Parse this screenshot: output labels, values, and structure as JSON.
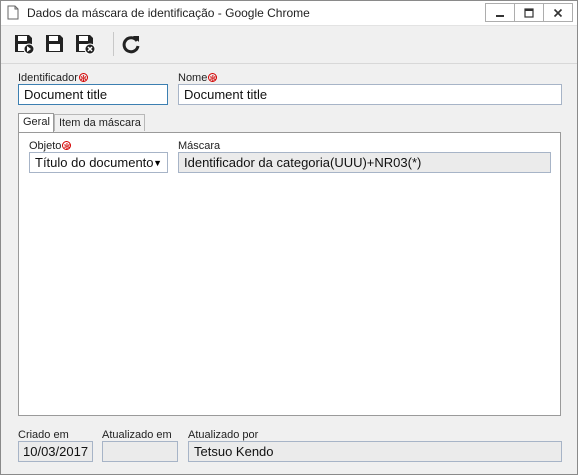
{
  "window": {
    "title": "Dados da máscara de identificação - Google Chrome"
  },
  "toolbar": {
    "buttons": [
      "save-new-icon",
      "save-icon",
      "save-close-icon",
      "refresh-icon"
    ]
  },
  "form": {
    "identificador": {
      "label": "Identificador",
      "value": "Document title"
    },
    "nome": {
      "label": "Nome",
      "value": "Document title"
    },
    "required_mark": "✻"
  },
  "tabs": [
    {
      "label": "Geral",
      "active": true
    },
    {
      "label": "Item da máscara",
      "active": false
    }
  ],
  "geral": {
    "objeto": {
      "label": "Objeto",
      "value": "Título do documento"
    },
    "mascara": {
      "label": "Máscara",
      "value": "Identificador da categoria(UUU)+NR03(*)"
    }
  },
  "footer": {
    "criado_em": {
      "label": "Criado em",
      "value": "10/03/2017"
    },
    "atualizado_em": {
      "label": "Atualizado em",
      "value": ""
    },
    "atualizado_por": {
      "label": "Atualizado por",
      "value": "Tetsuo Kendo"
    }
  },
  "colors": {
    "save_icon": "#222222",
    "close_badge": "#222222",
    "required": "#d40000",
    "focus_border": "#3c7fb1"
  }
}
